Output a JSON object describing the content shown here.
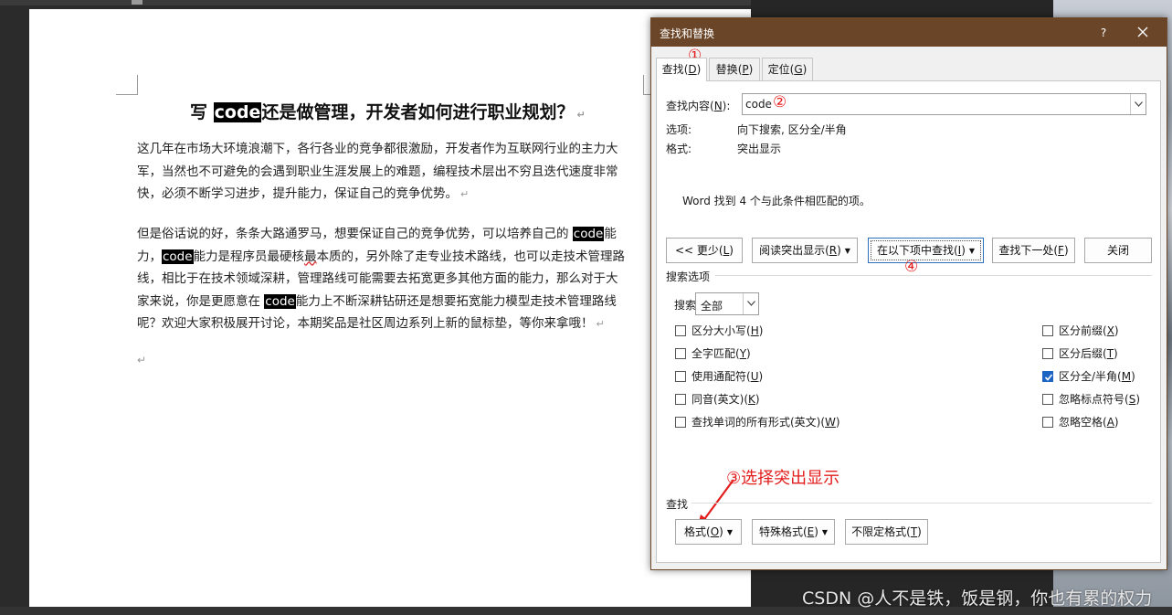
{
  "document": {
    "title_before": "写 ",
    "title_highlight": "code",
    "title_after": "还是做管理，开发者如何进行职业规划？",
    "return_mark": "↵",
    "p1_l1": "这几年在市场大环境浪潮下，各行各业的竞争都很激励，开发者作为互联网行业的主力大",
    "p1_l2": "军，当然也不可避免的会遇到职业生涯发展上的难题，编程技术层出不穷且迭代速度非常",
    "p1_l3": "快，必须不断学习进步，提升能力，保证自己的竞争优势。",
    "p2_l1a": "但是俗话说的好，条条大路通罗马，想要保证自己的竞争优势，可以培养自己的 ",
    "p2_l1b": "能",
    "p2_l2a": "力，",
    "p2_l2b": "能力是程序员最硬核",
    "p2_l2c": "最",
    "p2_l2d": "本质的，另外除了走专业技术路线，也可以走技术管理路",
    "p2_l3": "线，相比于在技术领域深耕，管理路线可能需要去拓宽更多其他方面的能力，那么对于大",
    "p2_l4a": "家来说，你是更愿意在 ",
    "p2_l4b": "能力上不断深耕钻研还是想要拓宽能力模型走技术管理路线",
    "p2_l5": "呢？欢迎大家积极展开讨论，本期奖品是社区周边系列上新的鼠标垫，等你来拿哦！",
    "highlight_word": "code"
  },
  "dialog": {
    "title": "查找和替换",
    "help": "?",
    "tabs": [
      {
        "label": "查找",
        "key": "D"
      },
      {
        "label": "替换",
        "key": "P"
      },
      {
        "label": "定位",
        "key": "G"
      }
    ],
    "find_label": "查找内容(",
    "find_key": "N",
    "find_label_end": "):",
    "find_value": "code",
    "options_label": "选项:",
    "options_value": "向下搜索, 区分全/半角",
    "format_label": "格式:",
    "format_value": "突出显示",
    "result_text": "Word 找到 4 个与此条件相匹配的项。",
    "buttons": {
      "less": "<< 更少(",
      "less_key": "L",
      "reading_highlight": "阅读突出显示(",
      "reading_highlight_key": "R",
      "find_in": "在以下项中查找(",
      "find_in_key": "I",
      "find_next": "查找下一处(",
      "find_next_key": "F",
      "close": "关闭"
    },
    "search_options_title": "搜索选项",
    "search_label": "搜索",
    "search_colon": ":",
    "search_value": "全部",
    "checkboxes_left": [
      {
        "label": "区分大小写(",
        "key": "H",
        "checked": false
      },
      {
        "label": "全字匹配(",
        "key": "Y",
        "checked": false
      },
      {
        "label": "使用通配符(",
        "key": "U",
        "checked": false
      },
      {
        "label": "同音(英文)(",
        "key": "K",
        "checked": false
      },
      {
        "label": "查找单词的所有形式(英文)(",
        "key": "W",
        "checked": false
      }
    ],
    "checkboxes_right": [
      {
        "label": "区分前缀(",
        "key": "X",
        "checked": false
      },
      {
        "label": "区分后缀(",
        "key": "T",
        "checked": false
      },
      {
        "label": "区分全/半角(",
        "key": "M",
        "checked": true
      },
      {
        "label": "忽略标点符号(",
        "key": "S",
        "checked": false
      },
      {
        "label": "忽略空格(",
        "key": "A",
        "checked": false
      }
    ],
    "find_section_label": "查找",
    "bottom_buttons": {
      "format": "格式(",
      "format_key": "O",
      "special": "特殊格式(",
      "special_key": "E",
      "no_format": "不限定格式(",
      "no_format_key": "T"
    }
  },
  "annotations": {
    "c1": "①",
    "c2": "②",
    "c3_text": "③选择突出显示",
    "c4": "④",
    "color": "#e31c1c"
  },
  "watermark": "CSDN @人不是铁，饭是钢，你也有累的权力",
  "colors": {
    "titlebar": "#6b4527",
    "checkbox_on": "#1c65c2",
    "highlight_bg": "#000000"
  }
}
